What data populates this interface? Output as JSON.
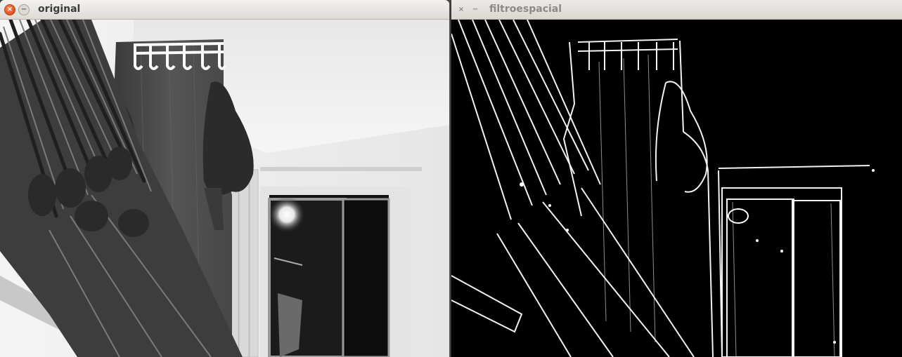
{
  "windows": [
    {
      "title": "original",
      "state": "active",
      "close_glyph": "×",
      "minimize_glyph": "−",
      "icons": [
        "close-icon",
        "minimize-icon"
      ]
    },
    {
      "title": "filtroespacial",
      "state": "inactive",
      "close_glyph": "×",
      "minimize_glyph": "−",
      "icons": [
        "close-icon",
        "minimize-icon"
      ]
    }
  ],
  "colors": {
    "close_button_active": "#e0501c",
    "titlebar_active": "#f3f2ef",
    "titlebar_inactive": "#dad7d2",
    "filter_background": "#000000",
    "filter_edges": "#ffffff"
  }
}
